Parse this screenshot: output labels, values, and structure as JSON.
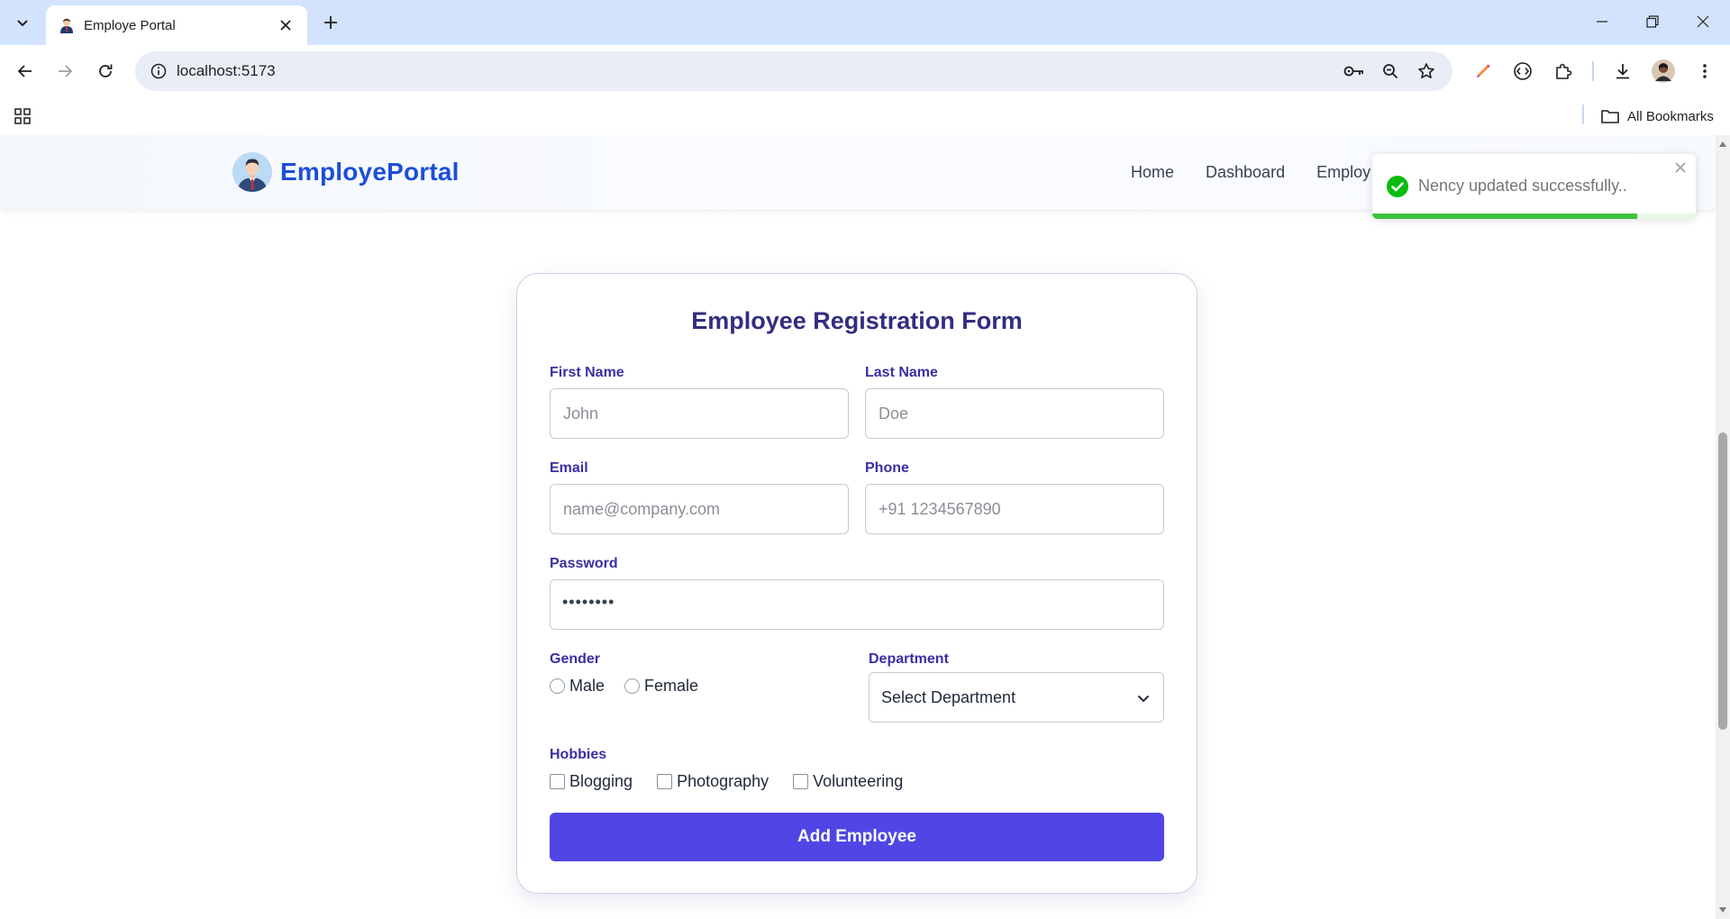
{
  "browser": {
    "tab": {
      "title": "Employe Portal"
    },
    "address": {
      "url": "localhost:5173"
    },
    "bookmarks": {
      "all_label": "All Bookmarks"
    }
  },
  "site": {
    "brand": "EmployePortal",
    "nav": [
      {
        "label": "Home"
      },
      {
        "label": "Dashboard"
      },
      {
        "label": "Employ"
      }
    ]
  },
  "toast": {
    "message": "Nency updated successfully..",
    "status": "success",
    "progress": 0.82
  },
  "form": {
    "title": "Employee Registration Form",
    "first_name": {
      "label": "First Name",
      "placeholder": "John"
    },
    "last_name": {
      "label": "Last Name",
      "placeholder": "Doe"
    },
    "email": {
      "label": "Email",
      "placeholder": "name@company.com"
    },
    "phone": {
      "label": "Phone",
      "placeholder": "+91 1234567890"
    },
    "password": {
      "label": "Password",
      "masked_value": "••••••••"
    },
    "gender": {
      "label": "Gender",
      "options": [
        "Male",
        "Female"
      ]
    },
    "department": {
      "label": "Department",
      "selected": "Select Department"
    },
    "hobbies": {
      "label": "Hobbies",
      "options": [
        "Blogging",
        "Photography",
        "Volunteering"
      ]
    },
    "submit_label": "Add Employee"
  },
  "colors": {
    "accent": "#4f46e5",
    "brand": "#1d4ed8",
    "label": "#3730a3",
    "title": "#312e81",
    "success": "#3cc23f",
    "chrome_tabbar": "#d3e3fd"
  }
}
